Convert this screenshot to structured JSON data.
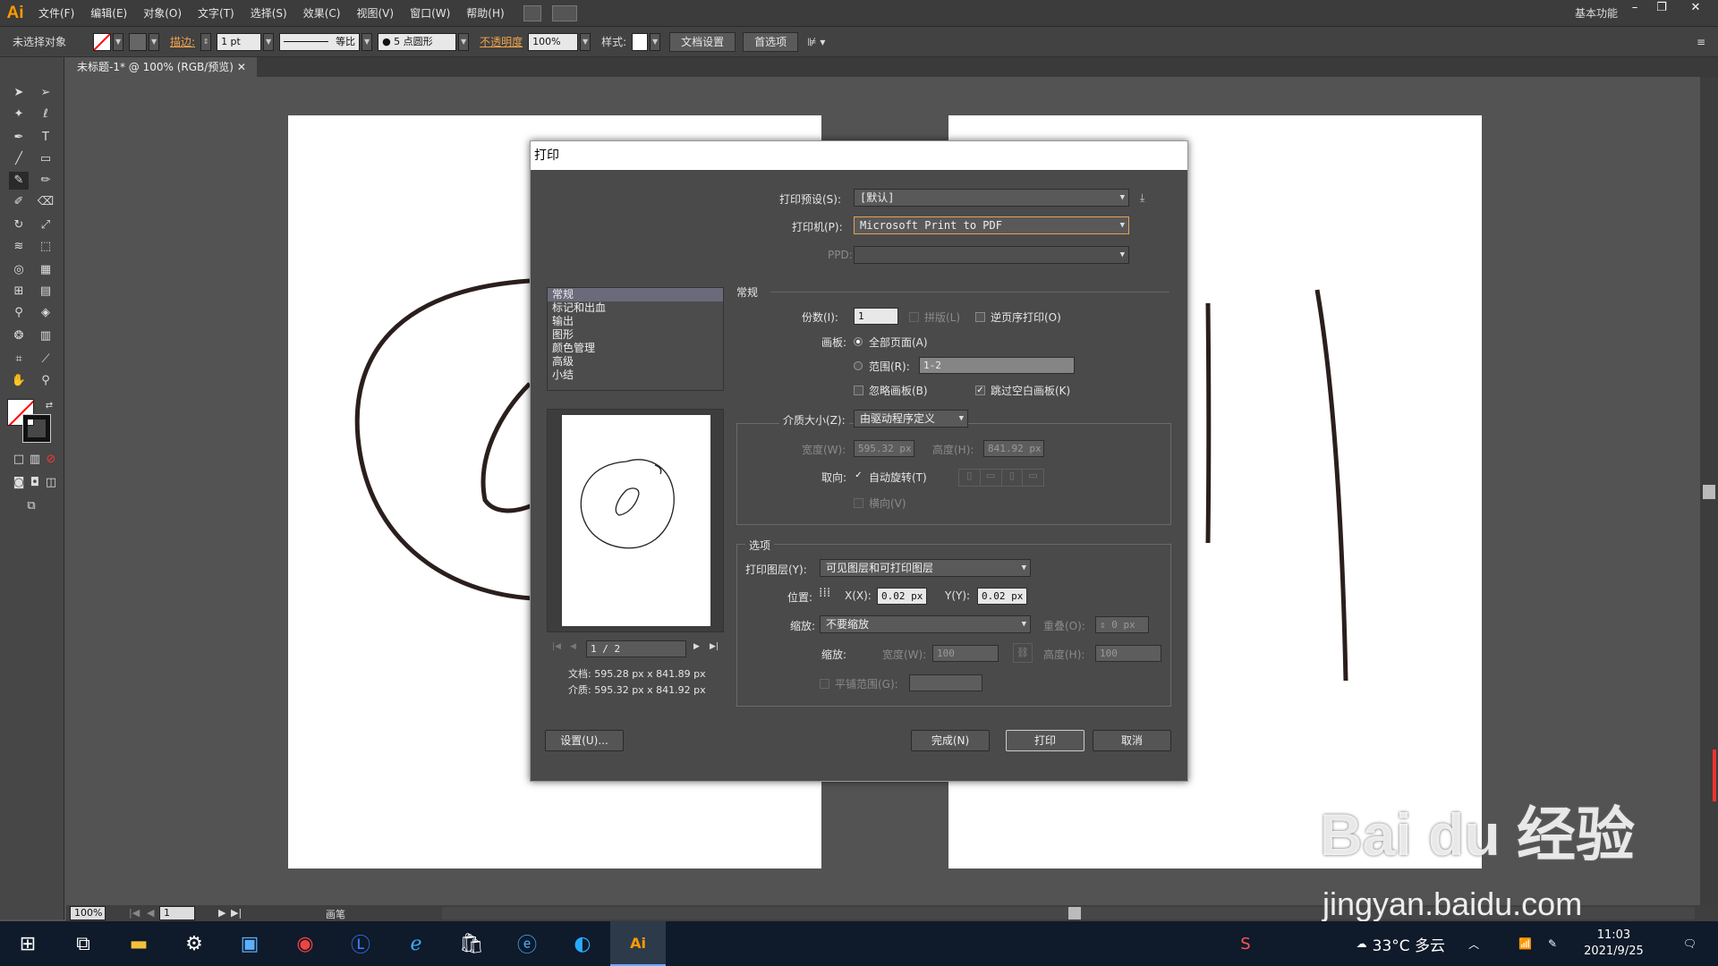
{
  "app": {
    "logo": "Ai",
    "workspace": "基本功能"
  },
  "menu": [
    "文件(F)",
    "编辑(E)",
    "对象(O)",
    "文字(T)",
    "选择(S)",
    "效果(C)",
    "视图(V)",
    "窗口(W)",
    "帮助(H)"
  ],
  "control": {
    "no_selection": "未选择对象",
    "stroke_label": "描边:",
    "stroke_value": "1 pt",
    "profile": "等比",
    "brush": "5 点圆形",
    "opacity_label": "不透明度",
    "opacity_value": "100%",
    "style_label": "样式:",
    "doc_setup": "文档设置",
    "preferences": "首选项"
  },
  "doc_tab": "未标题-1* @ 100% (RGB/预览)",
  "status": {
    "zoom": "100%",
    "page": "1",
    "tool": "画笔"
  },
  "dialog": {
    "title": "打印",
    "preset_label": "打印预设(S):",
    "preset_value": "[默认]",
    "printer_label": "打印机(P):",
    "printer_value": "Microsoft Print to PDF",
    "ppd_label": "PPD:",
    "categories": [
      "常规",
      "标记和出血",
      "输出",
      "图形",
      "颜色管理",
      "高级",
      "小结"
    ],
    "page_nav": "1 / 2",
    "doc_size": "文档: 595.28 px x 841.89 px",
    "media_size": "介质: 595.32 px x 841.92 px",
    "general_header": "常规",
    "copies_label": "份数(I):",
    "copies_value": "1",
    "collate": "拼版(L)",
    "reverse": "逆页序打印(O)",
    "artboards_label": "画板:",
    "all_pages": "全部页面(A)",
    "range_label": "范围(R):",
    "range_value": "1-2",
    "ignore_artboards": "忽略画板(B)",
    "skip_blank": "跳过空白画板(K)",
    "media_label": "介质大小(Z):",
    "media_value": "由驱动程序定义",
    "width_label": "宽度(W):",
    "width_value": "595.32 px",
    "height_label": "高度(H):",
    "height_value": "841.92 px",
    "orient_label": "取向:",
    "auto_rotate": "自动旋转(T)",
    "landscape": "横向(V)",
    "options_header": "选项",
    "print_layers_label": "打印图层(Y):",
    "print_layers_value": "可见图层和可打印图层",
    "position_label": "位置:",
    "x_label": "X(X):",
    "x_value": "0.02 px",
    "y_label": "Y(Y):",
    "y_value": "0.02 px",
    "scaling_label": "缩放:",
    "scaling_value": "不要缩放",
    "overlap_label": "重叠(O):",
    "overlap_value": "0 px",
    "scale_label": "缩放:",
    "scale_w_label": "宽度(W):",
    "scale_w_value": "100",
    "scale_h_label": "高度(H):",
    "scale_h_value": "100",
    "tile_range": "平铺范围(G):",
    "setup_btn": "设置(U)...",
    "done_btn": "完成(N)",
    "print_btn": "打印",
    "cancel_btn": "取消"
  },
  "tray": {
    "weather": "33°C 多云",
    "time": "11:03",
    "date": "2021/9/25"
  },
  "watermark": {
    "brand": "Bai du 经验",
    "url": "jingyan.baidu.com"
  }
}
